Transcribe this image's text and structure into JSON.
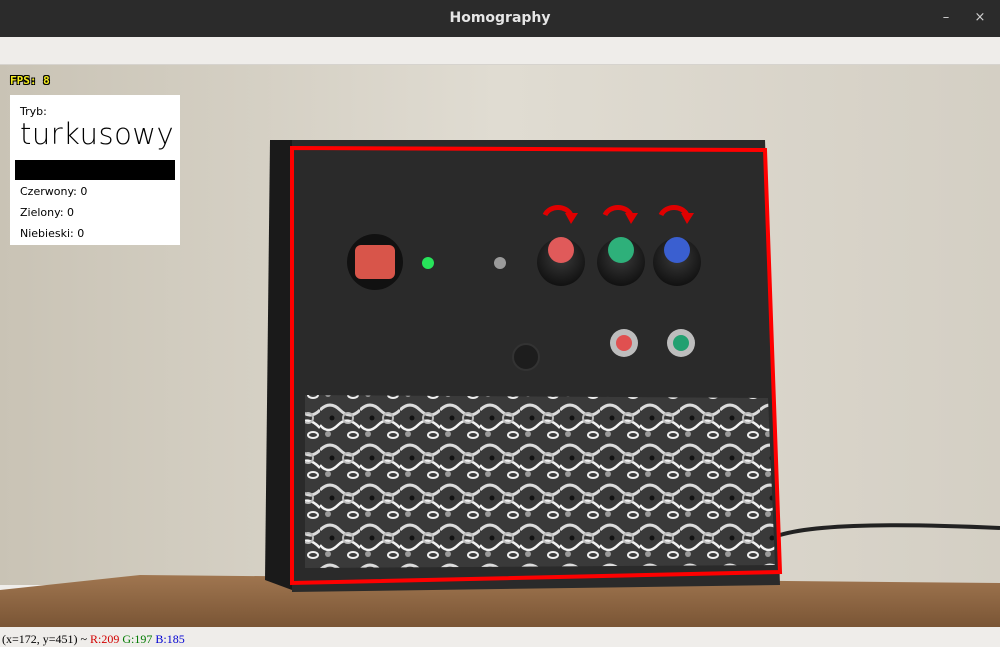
{
  "window": {
    "title": "Homography",
    "minimize_glyph": "–",
    "close_glyph": "×"
  },
  "overlay": {
    "fps_label": "FPS:",
    "fps_value": "8"
  },
  "panel": {
    "mode_label": "Tryb:",
    "mode_value": "turkusowy",
    "mode_bar_color": "#000000",
    "counters": [
      {
        "label": "Czerwony:",
        "value": "0"
      },
      {
        "label": "Zielony:",
        "value": "0"
      },
      {
        "label": "Niebieski:",
        "value": "0"
      }
    ]
  },
  "scene": {
    "detection_outline_color": "#ff0000",
    "knob_colors": [
      "#e05a5a",
      "#2eb07a",
      "#3a5fd0"
    ],
    "button_colors": [
      "#e05050",
      "#22a070"
    ],
    "led_color": "#27e35a",
    "rotation_arrow_color": "#e00000"
  },
  "status": {
    "coords": "(x=172, y=451) ~",
    "r": "R:209",
    "g": "G:197",
    "b": "B:185"
  }
}
